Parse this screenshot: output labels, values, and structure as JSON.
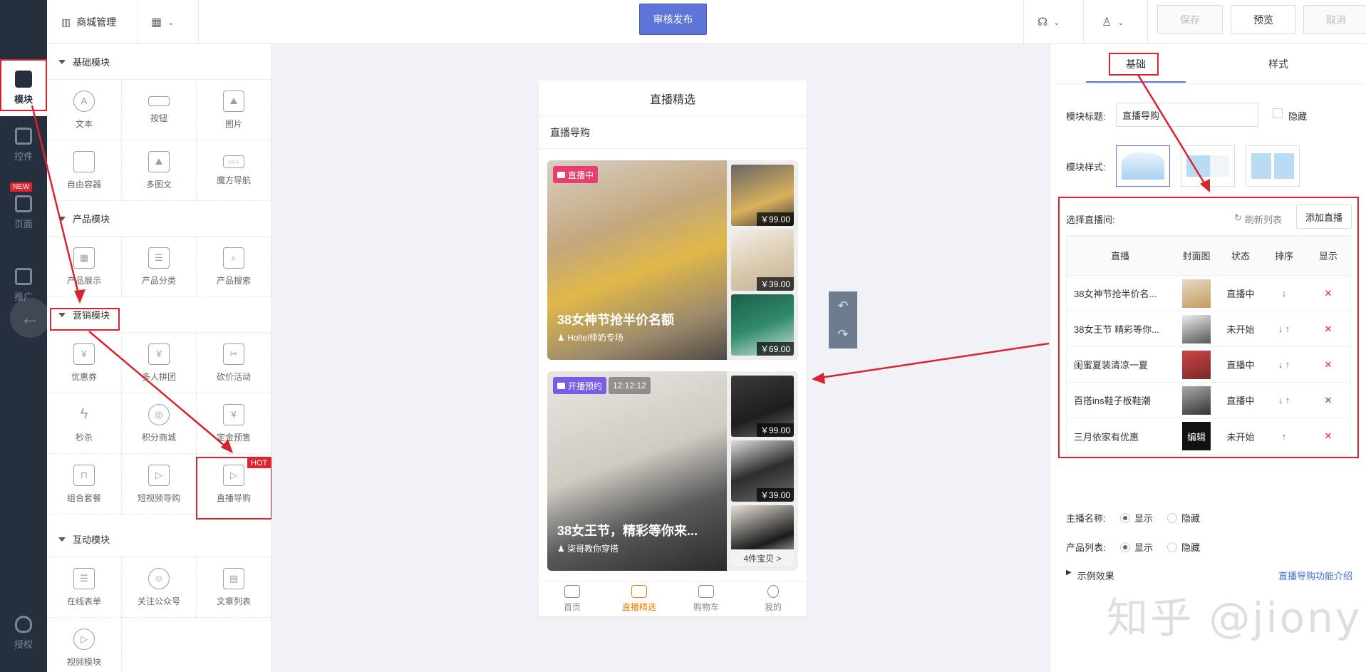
{
  "rail": {
    "items": [
      {
        "label": "模块",
        "icon": "module-icon"
      },
      {
        "label": "控件",
        "icon": "widget-icon"
      },
      {
        "label": "页面",
        "icon": "page-icon"
      },
      {
        "label": "推广",
        "icon": "promote-icon"
      },
      {
        "label": "授权",
        "icon": "shield-icon"
      }
    ],
    "new_badge": "NEW"
  },
  "topbar": {
    "title": "商城管理",
    "publish": "审核发布",
    "save": "保存",
    "preview": "预览",
    "cancel": "取消"
  },
  "modules": {
    "basic": {
      "title": "基础模块",
      "items": [
        "文本",
        "按钮",
        "图片",
        "自由容器",
        "多图文",
        "魔方导航"
      ]
    },
    "product": {
      "title": "产品模块",
      "items": [
        "产品展示",
        "产品分类",
        "产品搜索"
      ]
    },
    "marketing": {
      "title": "营销模块",
      "items": [
        "优惠券",
        "多人拼团",
        "砍价活动",
        "秒杀",
        "积分商城",
        "定金预售",
        "组合套餐",
        "短视频导购",
        "直播导购"
      ],
      "hot": "HOT"
    },
    "interactive": {
      "title": "互动模块",
      "items": [
        "在线表单",
        "关注公众号",
        "文章列表",
        "视频模块"
      ]
    }
  },
  "phone": {
    "title": "直播精选",
    "section": "直播导购",
    "cards": [
      {
        "tag": "直播中",
        "time": "",
        "title": "38女神节抢半价名额",
        "anchor": "Holtel师奶专场",
        "prices": [
          "￥99.00",
          "￥39.00",
          "￥69.00"
        ],
        "more": ""
      },
      {
        "tag": "开播预约",
        "time": "12:12:12",
        "title": "38女王节，精彩等你来...",
        "anchor": "柒哥教你穿搭",
        "prices": [
          "￥99.00",
          "￥39.00"
        ],
        "more": "4件宝贝 >"
      }
    ],
    "tabs": [
      "首页",
      "直播精选",
      "购物车",
      "我的"
    ]
  },
  "right": {
    "tabs": [
      "基础",
      "样式"
    ],
    "module_title_label": "模块标题:",
    "module_title_value": "直播导购",
    "hide_label": "隐藏",
    "module_style_label": "模块样式:",
    "select_label": "选择直播间:",
    "refresh": "刷新列表",
    "add": "添加直播",
    "columns": [
      "直播",
      "封面图",
      "状态",
      "排序",
      "显示"
    ],
    "rows": [
      {
        "name": "38女神节抢半价名...",
        "status": "直播中",
        "sort": "↓",
        "cover_text": ""
      },
      {
        "name": "38女王节 精彩等你...",
        "status": "未开始",
        "sort": "↓ ↑",
        "cover_text": ""
      },
      {
        "name": "闺蜜夏装清凉一夏",
        "status": "直播中",
        "sort": "↓ ↑",
        "cover_text": ""
      },
      {
        "name": "百搭ins鞋子板鞋潮",
        "status": "直播中",
        "sort": "↓ ↑",
        "cover_text": ""
      },
      {
        "name": "三月依家有优惠",
        "status": "未开始",
        "sort": "↑",
        "cover_text": "编辑"
      }
    ],
    "anchor_name_label": "主播名称:",
    "product_list_label": "产品列表:",
    "show": "显示",
    "hide": "隐藏",
    "example": "示例效果",
    "intro_link": "直播导购功能介绍"
  },
  "watermark": "知乎 @jiony",
  "colors": {
    "primary": "#5d74d9",
    "highlight_red": "#d9232e",
    "accent_orange": "#ff7a00",
    "rail_bg": "#262f3d"
  }
}
